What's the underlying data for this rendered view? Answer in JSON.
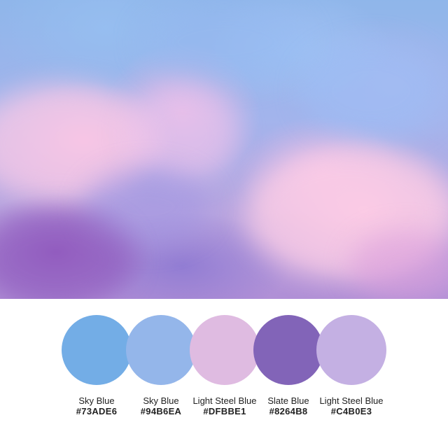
{
  "palette": {
    "swatches": [
      {
        "name": "Sky Blue",
        "hex": "#73ADE6",
        "color": "#73ADE6"
      },
      {
        "name": "Sky Blue",
        "hex": "#94B6EA",
        "color": "#94B6EA"
      },
      {
        "name": "Light Steel Blue",
        "hex": "#DFBBE1",
        "color": "#DFBBE1"
      },
      {
        "name": "Slate Blue",
        "hex": "#8264B8",
        "color": "#8264B8"
      },
      {
        "name": "Light Steel Blue",
        "hex": "#C4B0E3",
        "color": "#C4B0E3"
      }
    ]
  }
}
